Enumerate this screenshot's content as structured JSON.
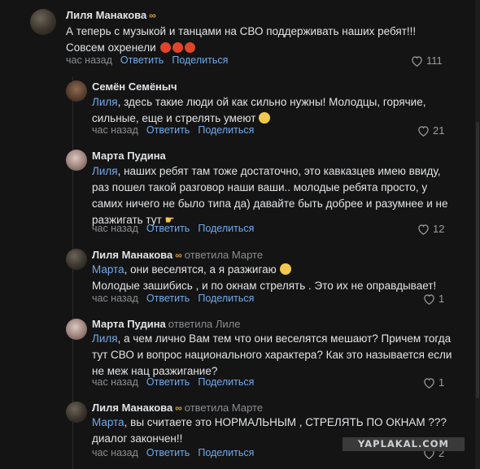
{
  "actions": {
    "time": "час назад",
    "reply": "Ответить",
    "share": "Поделиться"
  },
  "comments": [
    {
      "author": "Лиля Манакова",
      "badge": "∞",
      "text_lines": [
        "А теперь с музыкой и танцами на СВО поддерживать наших ребят!!!",
        "Совсем охренели"
      ],
      "likes": "111"
    },
    {
      "author": "Семён Семёныч",
      "mention": "Лиля",
      "text_lines": [
        ", здесь такие люди ой как сильно нужны! Молодцы, горячие,",
        "сильные, еще и стрелять умеют"
      ],
      "likes": "21"
    },
    {
      "author": "Марта Пудина",
      "mention": "Лиля",
      "text_lines": [
        ", наших ребят там тоже достаточно, это кавказцев имею ввиду,",
        "раз пошел такой разговор наши ваши.. молодые ребята просто, у",
        "самих ничего не было типа да) давайте быть добрее и разумнее и не",
        "разжигать тут"
      ],
      "likes": "12"
    },
    {
      "author": "Лиля Манакова",
      "badge": "∞",
      "reply_to": "ответила Марте",
      "mention": "Марта",
      "text_lines": [
        ", они веселятся, а я разжигаю",
        "Молодые зашибись , и по окнам стрелять . Это их не оправдывает!"
      ],
      "likes": "1"
    },
    {
      "author": "Марта Пудина",
      "reply_to": "ответила Лиле",
      "mention": "Лиля",
      "text_lines": [
        ", а чем лично Вам тем что они веселятся мешают? Причем тогда",
        "тут СВО и вопрос национального характера? Как это называется если",
        "не меж нац разжигание?"
      ],
      "likes": "1"
    },
    {
      "author": "Лиля Манакова",
      "badge": "∞",
      "reply_to": "ответила Марте",
      "mention": "Марта",
      "text_lines": [
        ", вы считаете это НОРМАЛЬНЫМ , СТРЕЛЯТЬ ПО ОКНАМ ???",
        "диалог закончен!!"
      ],
      "likes": "2"
    }
  ],
  "watermark": "YAPLAKAL.COM"
}
